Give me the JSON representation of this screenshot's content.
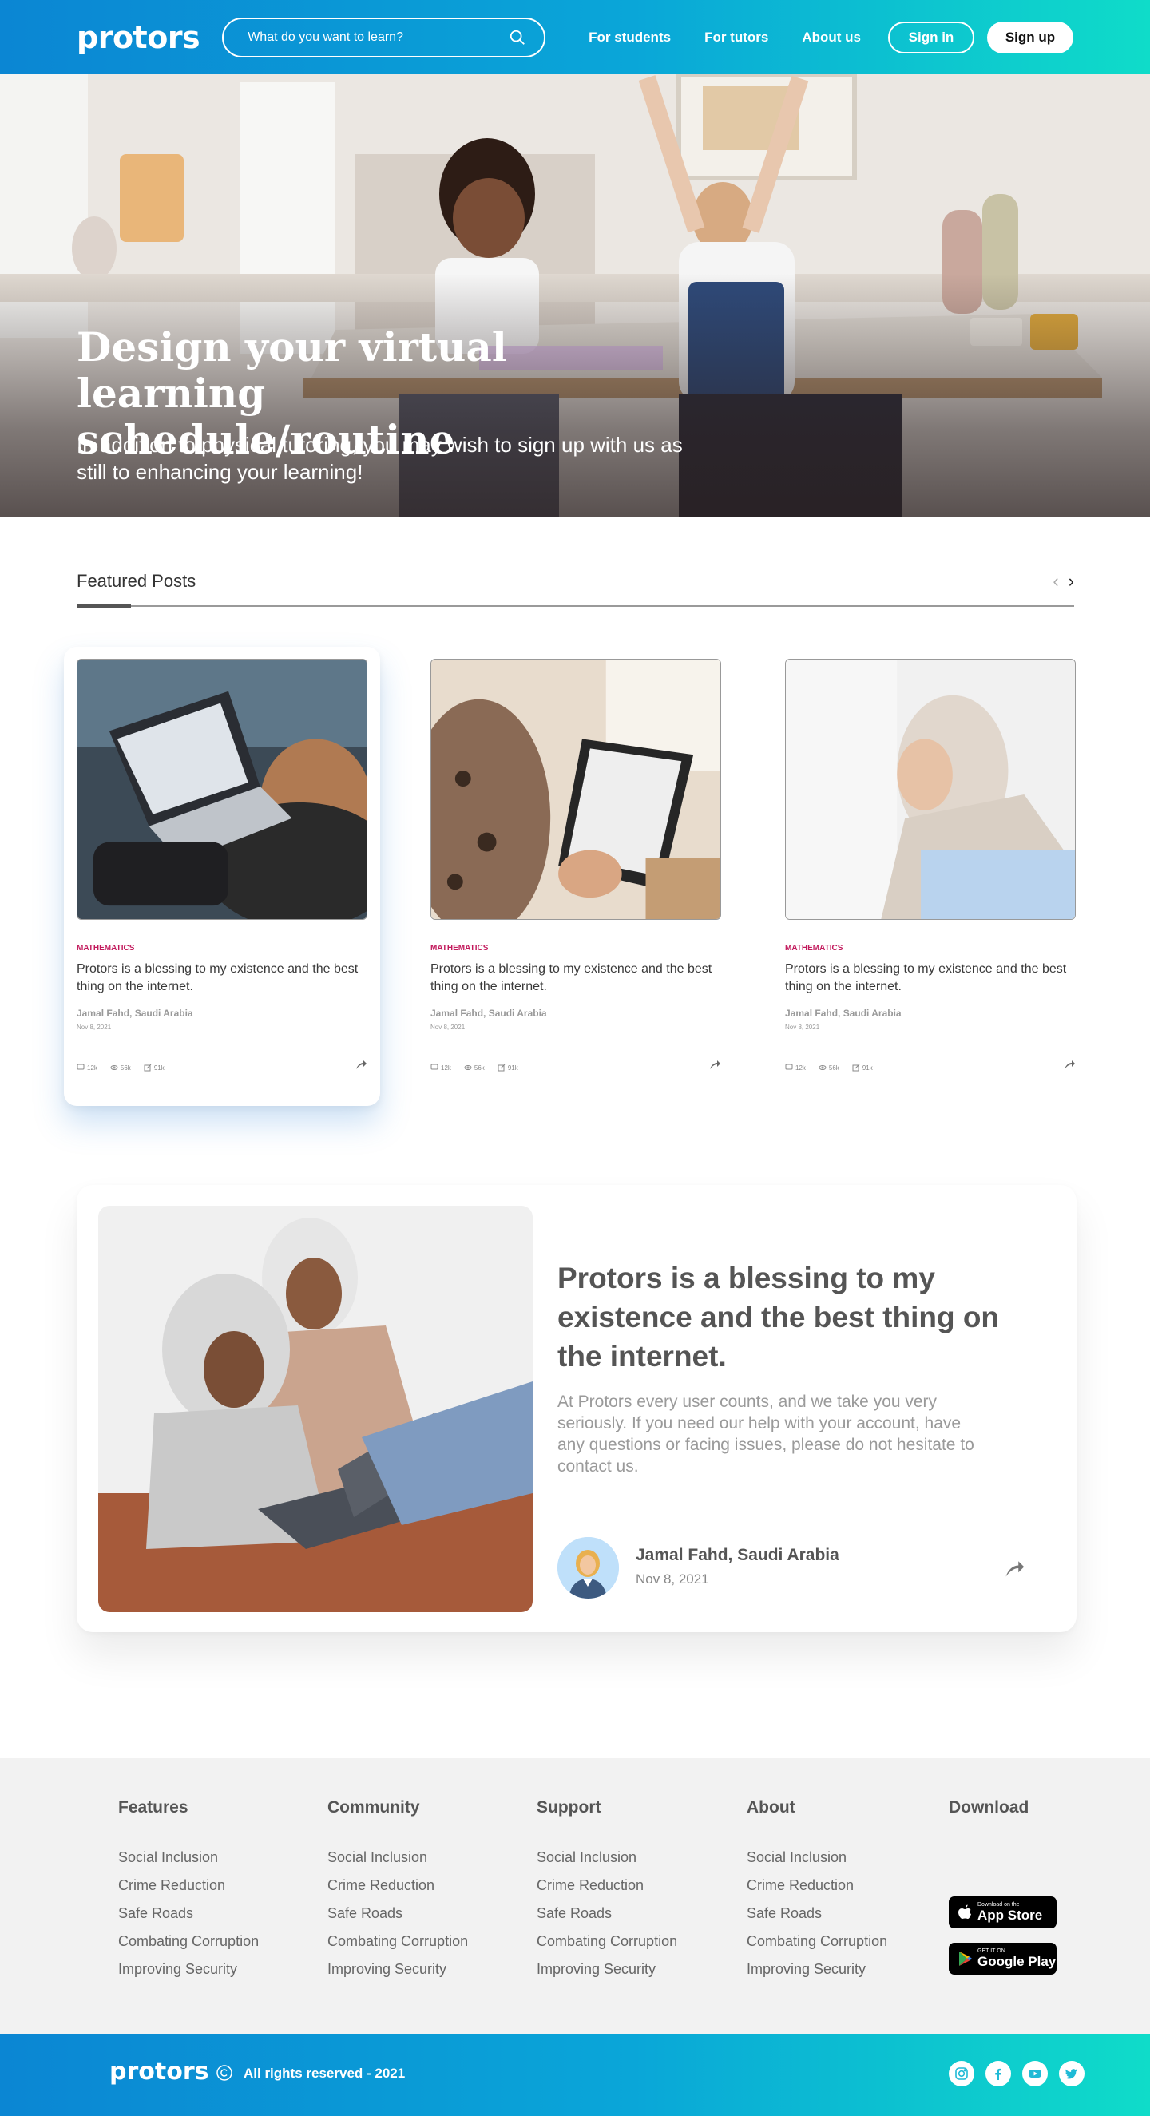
{
  "header": {
    "logo": "protors",
    "search_placeholder": "What do you want to learn?",
    "nav": [
      "For students",
      "For tutors",
      "About us"
    ],
    "signin_label": "Sign in",
    "signup_label": "Sign up"
  },
  "hero": {
    "title": "Design your virtual learning schedule/routine",
    "subtitle": "In addition to physical tutoring, you may wish to sign up with us as still to enhancing your learning!"
  },
  "featured": {
    "title": "Featured Posts",
    "cards": [
      {
        "category": "MATHEMATICS",
        "text": "Protors is a blessing to my existence and the best thing on the internet.",
        "author": "Jamal Fahd, Saudi Arabia",
        "date": "Nov 8, 2021",
        "comments": "12k",
        "views": "56k",
        "shares": "91k"
      },
      {
        "category": "MATHEMATICS",
        "text": "Protors is a blessing to my existence and the best thing on the internet.",
        "author": "Jamal Fahd, Saudi Arabia",
        "date": "Nov 8, 2021",
        "comments": "12k",
        "views": "56k",
        "shares": "91k"
      },
      {
        "category": "MATHEMATICS",
        "text": "Protors is a blessing to my existence and the best thing on the internet.",
        "author": "Jamal Fahd, Saudi Arabia",
        "date": "Nov 8, 2021",
        "comments": "12k",
        "views": "56k",
        "shares": "91k"
      }
    ]
  },
  "testimonial": {
    "title": "Protors is a blessing to my existence and the best thing on the internet.",
    "body": "At Protors every user counts, and we take you very seriously. If you need our help with your account, have any questions or facing issues, please do not hesitate to contact us.",
    "name": "Jamal Fahd, Saudi Arabia",
    "date": "Nov 8, 2021"
  },
  "footer": {
    "columns": [
      {
        "title": "Features",
        "items": [
          "Social Inclusion",
          "Crime Reduction",
          "Safe Roads",
          "Combating Corruption",
          "Improving Security"
        ]
      },
      {
        "title": "Community",
        "items": [
          "Social Inclusion",
          "Crime Reduction",
          "Safe Roads",
          "Combating Corruption",
          "Improving Security"
        ]
      },
      {
        "title": "Support",
        "items": [
          "Social Inclusion",
          "Crime Reduction",
          "Safe Roads",
          "Combating Corruption",
          "Improving Security"
        ]
      },
      {
        "title": "About",
        "items": [
          "Social Inclusion",
          "Crime Reduction",
          "Safe Roads",
          "Combating Corruption",
          "Improving Security"
        ]
      }
    ],
    "download_title": "Download",
    "appstore": {
      "small": "Download on the",
      "big": "App Store"
    },
    "googleplay": {
      "small": "GET IT ON",
      "big": "Google Play"
    },
    "bottom_logo": "protors",
    "copyright": "All rights reserved - 2021",
    "socials": [
      "instagram-icon",
      "facebook-icon",
      "youtube-icon",
      "twitter-icon"
    ]
  },
  "colors": {
    "brand_start": "#0b86d3",
    "brand_end": "#0fdcc9",
    "category": "#c2185b"
  }
}
